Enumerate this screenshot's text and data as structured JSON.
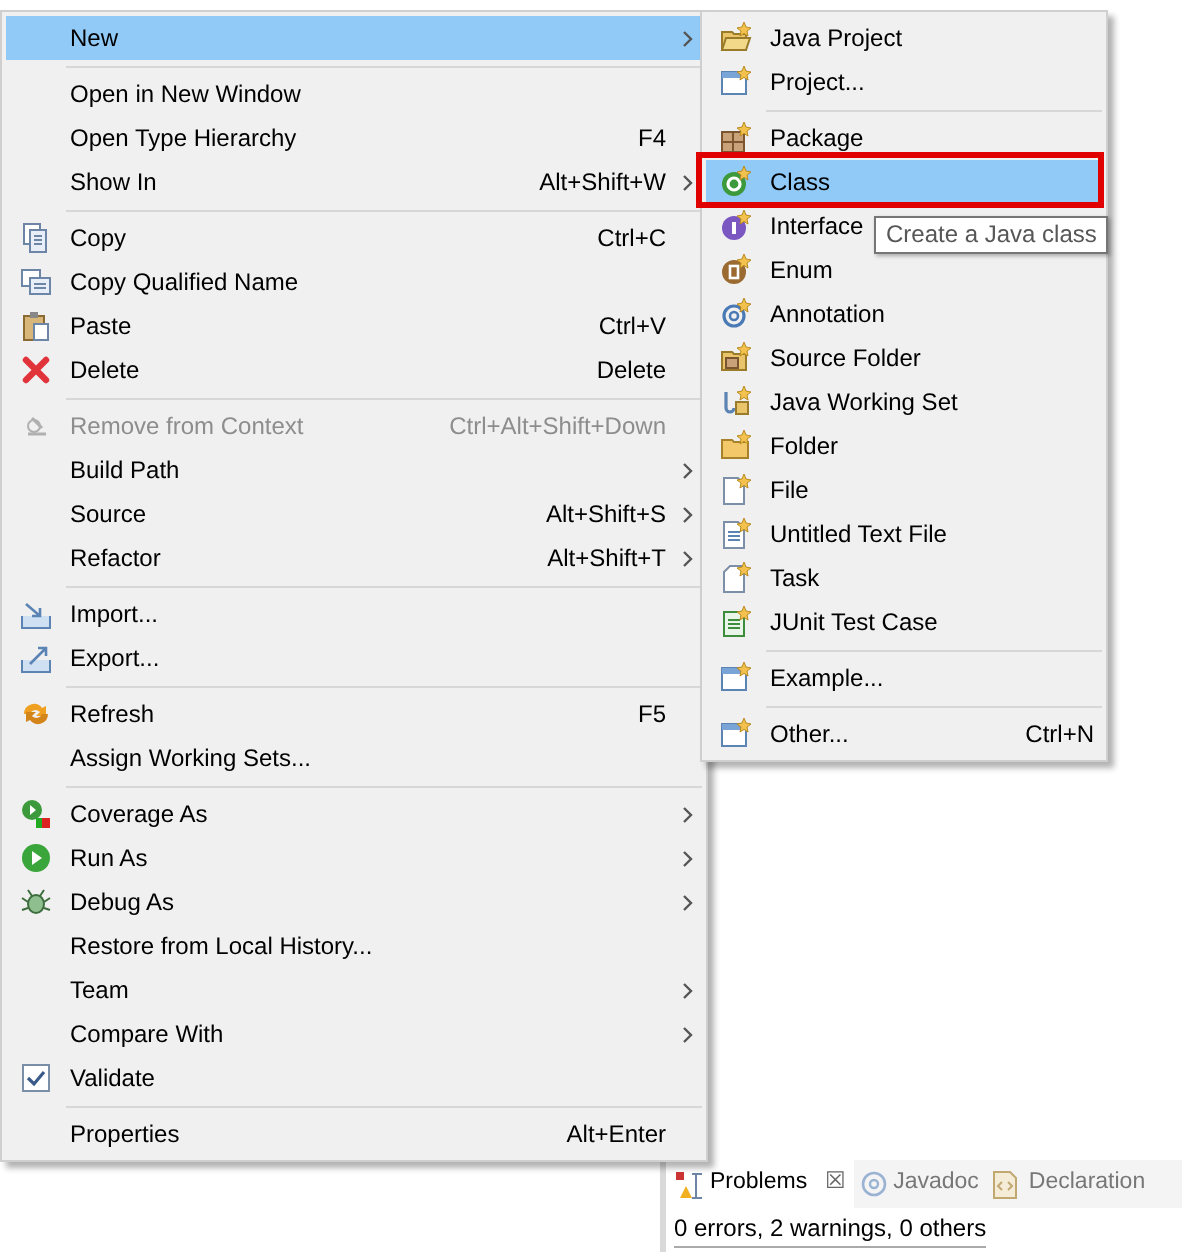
{
  "context_menu": {
    "items": [
      {
        "kind": "item",
        "label": "New",
        "submenu": true,
        "selected": true,
        "disabled": false
      },
      {
        "kind": "separator"
      },
      {
        "kind": "item",
        "label": "Open in New Window",
        "submenu": false,
        "selected": false,
        "disabled": false
      },
      {
        "kind": "item",
        "label": "Open Type Hierarchy",
        "shortcut": "F4",
        "submenu": false,
        "selected": false,
        "disabled": false
      },
      {
        "kind": "item",
        "label": "Show In",
        "shortcut": "Alt+Shift+W",
        "submenu": true,
        "selected": false,
        "disabled": false
      },
      {
        "kind": "separator"
      },
      {
        "kind": "item",
        "label": "Copy",
        "shortcut": "Ctrl+C",
        "submenu": false,
        "selected": false,
        "disabled": false
      },
      {
        "kind": "item",
        "label": "Copy Qualified Name",
        "submenu": false,
        "selected": false,
        "disabled": false
      },
      {
        "kind": "item",
        "label": "Paste",
        "shortcut": "Ctrl+V",
        "submenu": false,
        "selected": false,
        "disabled": false
      },
      {
        "kind": "item",
        "label": "Delete",
        "shortcut": "Delete",
        "submenu": false,
        "selected": false,
        "disabled": false
      },
      {
        "kind": "separator"
      },
      {
        "kind": "item",
        "label": "Remove from Context",
        "shortcut": "Ctrl+Alt+Shift+Down",
        "submenu": false,
        "selected": false,
        "disabled": true
      },
      {
        "kind": "item",
        "label": "Build Path",
        "submenu": true,
        "selected": false,
        "disabled": false
      },
      {
        "kind": "item",
        "label": "Source",
        "shortcut": "Alt+Shift+S",
        "submenu": true,
        "selected": false,
        "disabled": false
      },
      {
        "kind": "item",
        "label": "Refactor",
        "shortcut": "Alt+Shift+T",
        "submenu": true,
        "selected": false,
        "disabled": false
      },
      {
        "kind": "separator"
      },
      {
        "kind": "item",
        "label": "Import...",
        "submenu": false,
        "selected": false,
        "disabled": false
      },
      {
        "kind": "item",
        "label": "Export...",
        "submenu": false,
        "selected": false,
        "disabled": false
      },
      {
        "kind": "separator"
      },
      {
        "kind": "item",
        "label": "Refresh",
        "shortcut": "F5",
        "submenu": false,
        "selected": false,
        "disabled": false
      },
      {
        "kind": "item",
        "label": "Assign Working Sets...",
        "submenu": false,
        "selected": false,
        "disabled": false
      },
      {
        "kind": "separator"
      },
      {
        "kind": "item",
        "label": "Coverage As",
        "submenu": true,
        "selected": false,
        "disabled": false
      },
      {
        "kind": "item",
        "label": "Run As",
        "submenu": true,
        "selected": false,
        "disabled": false
      },
      {
        "kind": "item",
        "label": "Debug As",
        "submenu": true,
        "selected": false,
        "disabled": false
      },
      {
        "kind": "item",
        "label": "Restore from Local History...",
        "submenu": false,
        "selected": false,
        "disabled": false
      },
      {
        "kind": "item",
        "label": "Team",
        "submenu": true,
        "selected": false,
        "disabled": false
      },
      {
        "kind": "item",
        "label": "Compare With",
        "submenu": true,
        "selected": false,
        "disabled": false
      },
      {
        "kind": "check",
        "label": "Validate",
        "checked": true,
        "submenu": false,
        "selected": false,
        "disabled": false
      },
      {
        "kind": "separator"
      },
      {
        "kind": "item",
        "label": "Properties",
        "shortcut": "Alt+Enter",
        "submenu": false,
        "selected": false,
        "disabled": false
      }
    ]
  },
  "new_submenu": {
    "items": [
      {
        "kind": "item",
        "label": "Java Project",
        "selected": false
      },
      {
        "kind": "item",
        "label": "Project...",
        "selected": false
      },
      {
        "kind": "separator"
      },
      {
        "kind": "item",
        "label": "Package",
        "selected": false
      },
      {
        "kind": "item",
        "label": "Class",
        "selected": true
      },
      {
        "kind": "item",
        "label": "Interface",
        "selected": false
      },
      {
        "kind": "item",
        "label": "Enum",
        "selected": false
      },
      {
        "kind": "item",
        "label": "Annotation",
        "selected": false
      },
      {
        "kind": "item",
        "label": "Source Folder",
        "selected": false
      },
      {
        "kind": "item",
        "label": "Java Working Set",
        "selected": false
      },
      {
        "kind": "item",
        "label": "Folder",
        "selected": false
      },
      {
        "kind": "item",
        "label": "File",
        "selected": false
      },
      {
        "kind": "item",
        "label": "Untitled Text File",
        "selected": false
      },
      {
        "kind": "item",
        "label": "Task",
        "selected": false
      },
      {
        "kind": "item",
        "label": "JUnit Test Case",
        "selected": false
      },
      {
        "kind": "separator"
      },
      {
        "kind": "item",
        "label": "Example...",
        "selected": false
      },
      {
        "kind": "separator"
      },
      {
        "kind": "item",
        "label": "Other...",
        "shortcut": "Ctrl+N",
        "selected": false
      }
    ]
  },
  "tooltip": "Create a Java class",
  "bottom_panel": {
    "tabs": [
      {
        "label": "Problems",
        "selected": true,
        "close": "☒"
      },
      {
        "label": "Javadoc",
        "selected": false
      },
      {
        "label": "Declaration",
        "selected": false
      }
    ],
    "status": "0 errors, 2 warnings, 0 others"
  }
}
